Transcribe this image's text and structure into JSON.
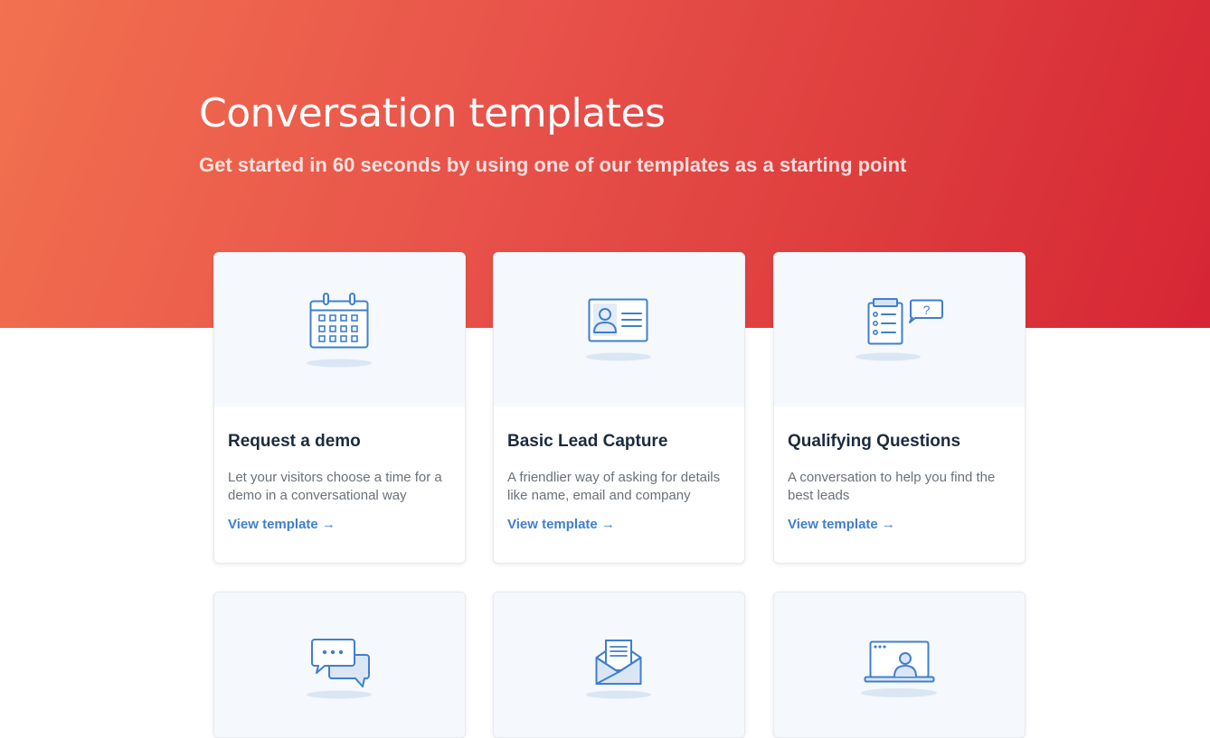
{
  "header": {
    "title": "Conversation templates",
    "subtitle": "Get started in 60 seconds by using one of our templates as a starting point"
  },
  "templates": [
    {
      "title": "Request a demo",
      "description": "Let your visitors choose a time for a demo in a conversational way",
      "link": "View template →",
      "icon": "calendar-icon"
    },
    {
      "title": "Basic Lead Capture",
      "description": "A friendlier way of asking for details like name, email and company",
      "link": "View template →",
      "icon": "id-card-icon"
    },
    {
      "title": "Qualifying Questions",
      "description": "A conversation to help you find the best leads",
      "link": "View template →",
      "icon": "checklist-question-icon"
    },
    {
      "icon": "chat-bubbles-icon"
    },
    {
      "icon": "envelope-letter-icon"
    },
    {
      "icon": "laptop-user-icon"
    }
  ],
  "colors": {
    "hero_gradient_start": "#f2714f",
    "hero_gradient_end": "#d62535",
    "icon_blue": "#3f7fd0",
    "link_blue": "#3f7fd0",
    "card_title": "#1d2b3e"
  }
}
